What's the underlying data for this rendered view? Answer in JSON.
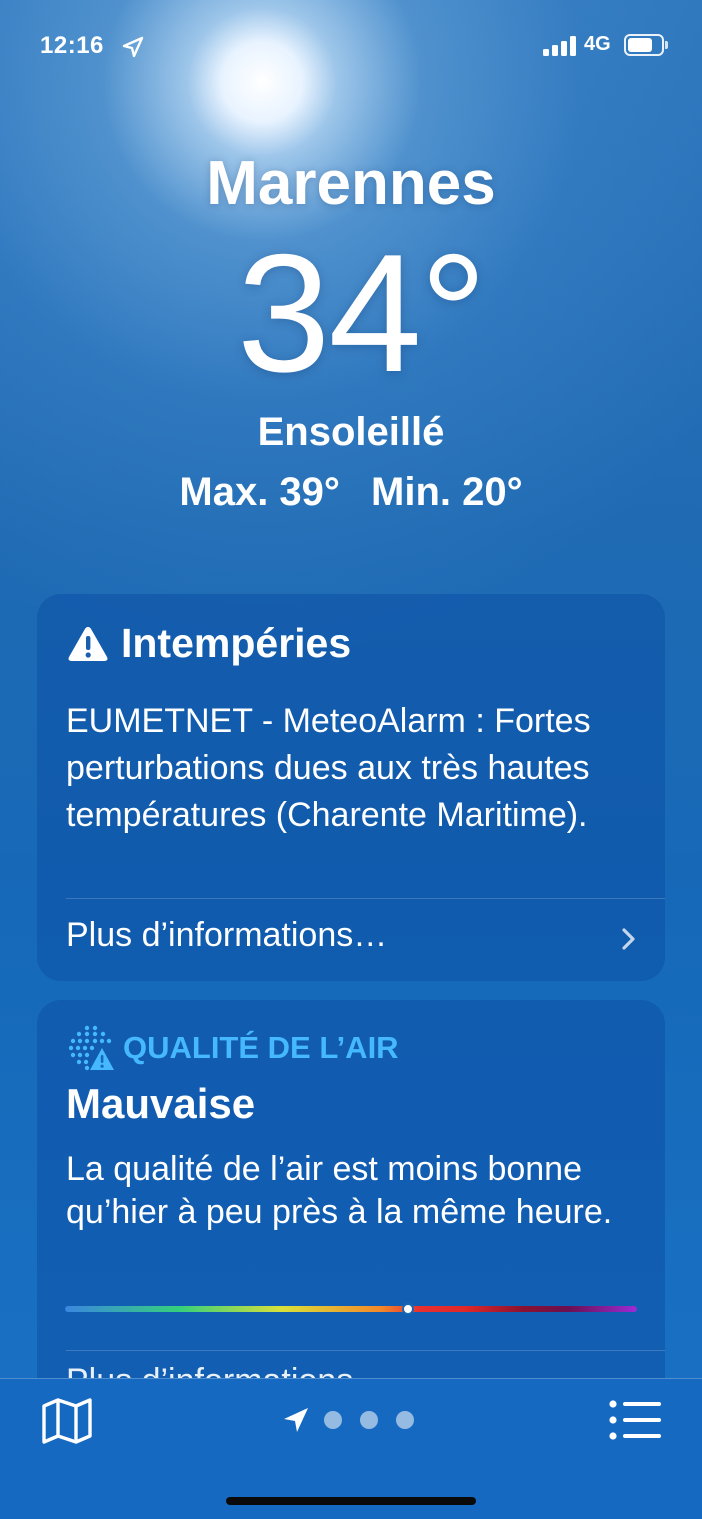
{
  "status_bar": {
    "time": "12:16",
    "network": "4G",
    "battery_level": 0.72
  },
  "header": {
    "city": "Marennes",
    "temperature": "34°",
    "condition": "Ensoleillé",
    "high": "Max. 39°",
    "low": "Min. 20°"
  },
  "alert_card": {
    "title": "Intempéries",
    "icon": "warning-triangle-icon",
    "text": "EUMETNET - MeteoAlarm : Fortes perturbations dues aux très hautes températures (Charente Maritime).",
    "link": "Plus d’informations…"
  },
  "air_quality_card": {
    "header": "QUALITÉ DE L’AIR",
    "icon": "air-quality-warning-icon",
    "level": "Mauvaise",
    "description": "La qualité de l’air est moins bonne qu’hier à peu près à la même heure.",
    "scale_position": 0.6,
    "link": "Plus d’informations…"
  },
  "toolbar": {
    "map_icon": "map-icon",
    "location_icon": "location-arrow-icon",
    "pages": 3,
    "list_icon": "list-icon"
  },
  "colors": {
    "accent_cyan": "#45b8ff",
    "card_bg": "rgba(12,80,165,0.55)",
    "toolbar_bg": "#1669c0"
  }
}
